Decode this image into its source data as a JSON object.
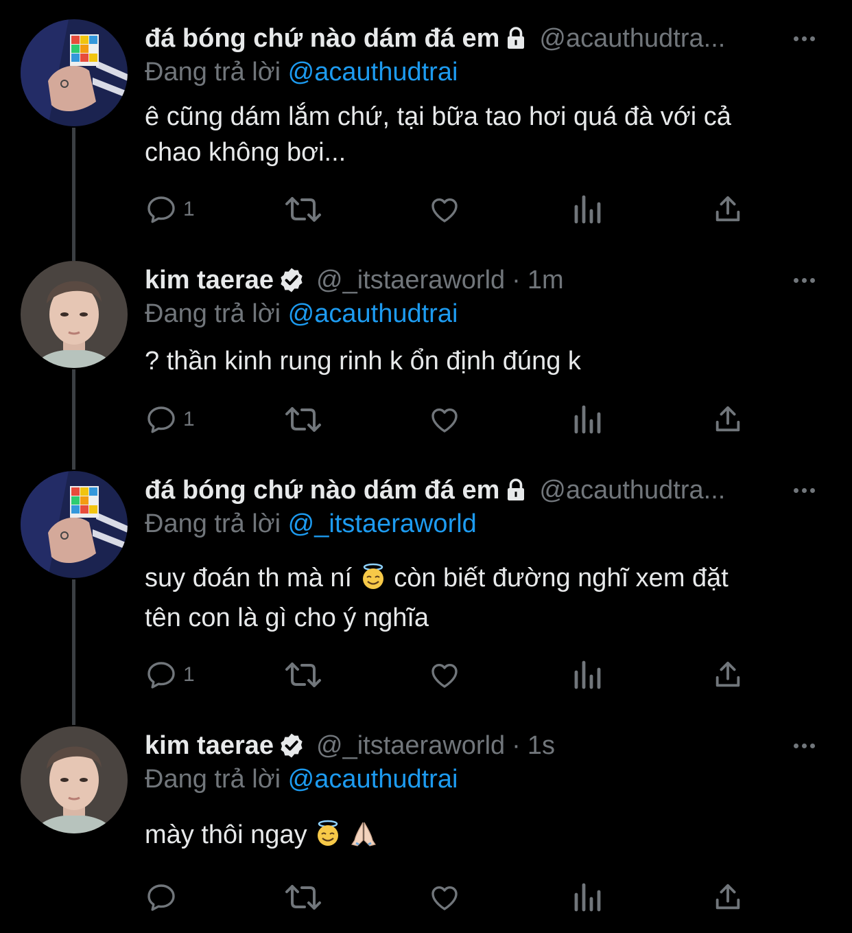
{
  "colors": {
    "background": "#000000",
    "text": "#e7e9ea",
    "muted": "#71767b",
    "mention": "#1d9bf0",
    "thread_line": "#3b3f43"
  },
  "tweets": [
    {
      "name": "đá bóng chứ nào dám đá em",
      "badge_icon": "lock-icon",
      "handle": "@acauthudtra...",
      "replying_label": "Đang trả lời",
      "replying_to": "@acauthudtrai",
      "text_lines": [
        "ê cũng dám lắm chứ, tại bữa tao hơi quá đà với cả",
        "chao không bơi..."
      ],
      "reply_count": "1"
    },
    {
      "name": "kim taerae",
      "badge_icon": "verified-badge-icon",
      "handle": "@_itstaeraworld",
      "dot": "·",
      "time": "1m",
      "replying_label": "Đang trả lời",
      "replying_to": "@acauthudtrai",
      "text_lines": [
        "? thần kinh rung rinh k ổn định đúng k"
      ],
      "reply_count": "1"
    },
    {
      "name": "đá bóng chứ nào dám đá em",
      "badge_icon": "lock-icon",
      "handle": "@acauthudtra...",
      "replying_label": "Đang trả lời",
      "replying_to": "@_itstaeraworld",
      "text_line1_before": "suy đoán th mà ní",
      "text_line1_after": "còn biết đường nghĩ xem đặt",
      "text_line2": "tên con là gì cho ý nghĩa",
      "reply_count": "1"
    },
    {
      "name": "kim taerae",
      "badge_icon": "verified-badge-icon",
      "handle": "@_itstaeraworld",
      "dot": "·",
      "time": "1s",
      "replying_label": "Đang trả lời",
      "replying_to": "@acauthudtrai",
      "text": "mày thôi ngay",
      "reply_count": ""
    }
  ]
}
